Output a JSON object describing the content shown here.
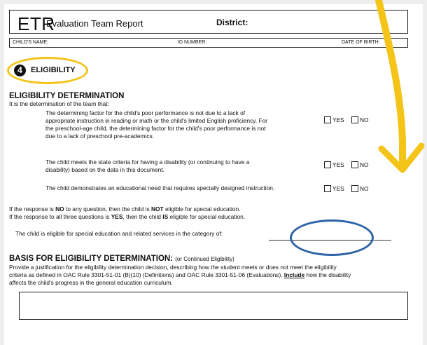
{
  "header": {
    "logo": "ETR",
    "title": "Evaluation Team Report",
    "district_label": "District:"
  },
  "id_row": {
    "childs_name": "CHILD'S NAME:",
    "id_number": "ID NUMBER:",
    "dob": "DATE OF BIRTH:"
  },
  "section": {
    "number": "4",
    "title": "ELIGIBILITY"
  },
  "eligibility": {
    "heading": "ELIGIBILITY DETERMINATION",
    "intro": "It is the determination of the team that:",
    "questions": [
      {
        "text_lines": [
          "The determining factor for the child's poor performance is not due to a lack of",
          "appropriate instruction in reading or math or the child's limited English proficiency.  For",
          "the preschool-age child, the determining factor for the child's poor performance is not",
          "due to a lack of preschool pre-academics."
        ],
        "yes": "YES",
        "no": "NO"
      },
      {
        "text_lines": [
          "The child meets the state criteria for having a disability (or continuing to have a",
          "disability) based on the data in this document."
        ],
        "yes": "YES",
        "no": "NO"
      },
      {
        "text_lines": [
          "The child demonstrates an educational need that requires specially designed instruction."
        ],
        "yes": "YES",
        "no": "NO"
      }
    ],
    "rule_no": {
      "pre": "If the response is ",
      "b1": "NO",
      "mid": " to any question, then the child is ",
      "b2": "NOT",
      "post": " eligible for special education."
    },
    "rule_yes": {
      "pre": "If the response to all three questions is ",
      "b1": "YES",
      "mid": ", then the child ",
      "b2": "IS",
      "post": " eligible for special education."
    },
    "category_line": "The child is eligible for special education and related services in the category of:"
  },
  "basis": {
    "heading": "BASIS FOR ELIGIBILITY DETERMINATION:",
    "heading_note": "(or Continued Eligibility)",
    "line1": "Provide a justification for the eligibility determination decision, describing how the student meets or does not meet the eligibility",
    "line2": "criteria as defined in OAC Rule 3301-51-01 (B)(10) (Definitions) and OAC Rule 3301-51-06 (Evaluations).",
    "include": "Include",
    "line2_post": " how the disability",
    "line3": "affects the child's progress in the general education curriculum."
  },
  "colors": {
    "highlight_yellow": "#f4c418",
    "annotation_blue": "#2e63a8"
  }
}
